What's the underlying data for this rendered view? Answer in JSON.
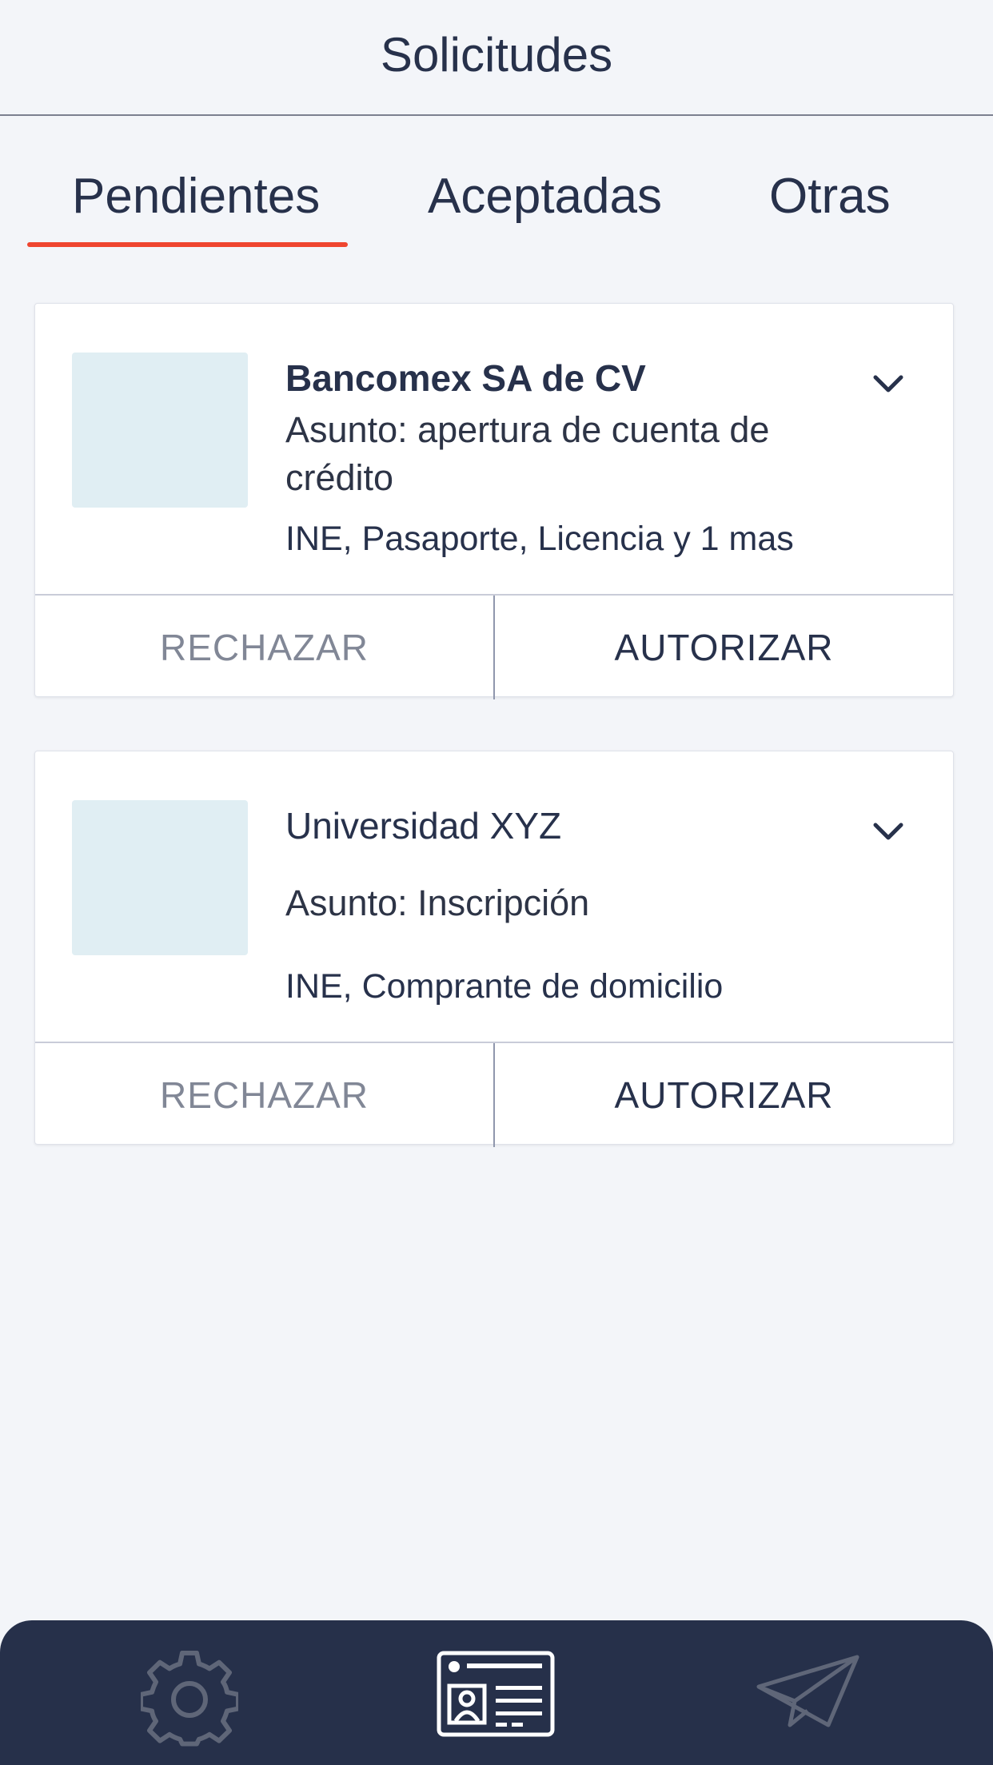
{
  "header": {
    "title": "Solicitudes"
  },
  "tabs": [
    {
      "label": "Pendientes",
      "active": true
    },
    {
      "label": "Aceptadas",
      "active": false
    },
    {
      "label": "Otras",
      "active": false
    }
  ],
  "requests": [
    {
      "title": "Bancomex SA de CV",
      "subject": "Asunto: apertura de cuenta de crédito",
      "documents": "INE, Pasaporte, Licencia y 1 mas",
      "reject_label": "RECHAZAR",
      "accept_label": "AUTORIZAR"
    },
    {
      "title": "Universidad XYZ",
      "subject": "Asunto: Inscripción",
      "documents": "INE, Comprante de domicilio",
      "reject_label": "RECHAZAR",
      "accept_label": "AUTORIZAR"
    }
  ],
  "bottom_nav": {
    "items": [
      {
        "icon": "gear-icon",
        "active": false
      },
      {
        "icon": "id-card-icon",
        "active": true
      },
      {
        "icon": "paper-plane-icon",
        "active": false
      }
    ]
  },
  "colors": {
    "accent": "#ef4630",
    "navy": "#26304a",
    "background": "#f3f5f9",
    "thumbnail": "#e0eef3"
  }
}
